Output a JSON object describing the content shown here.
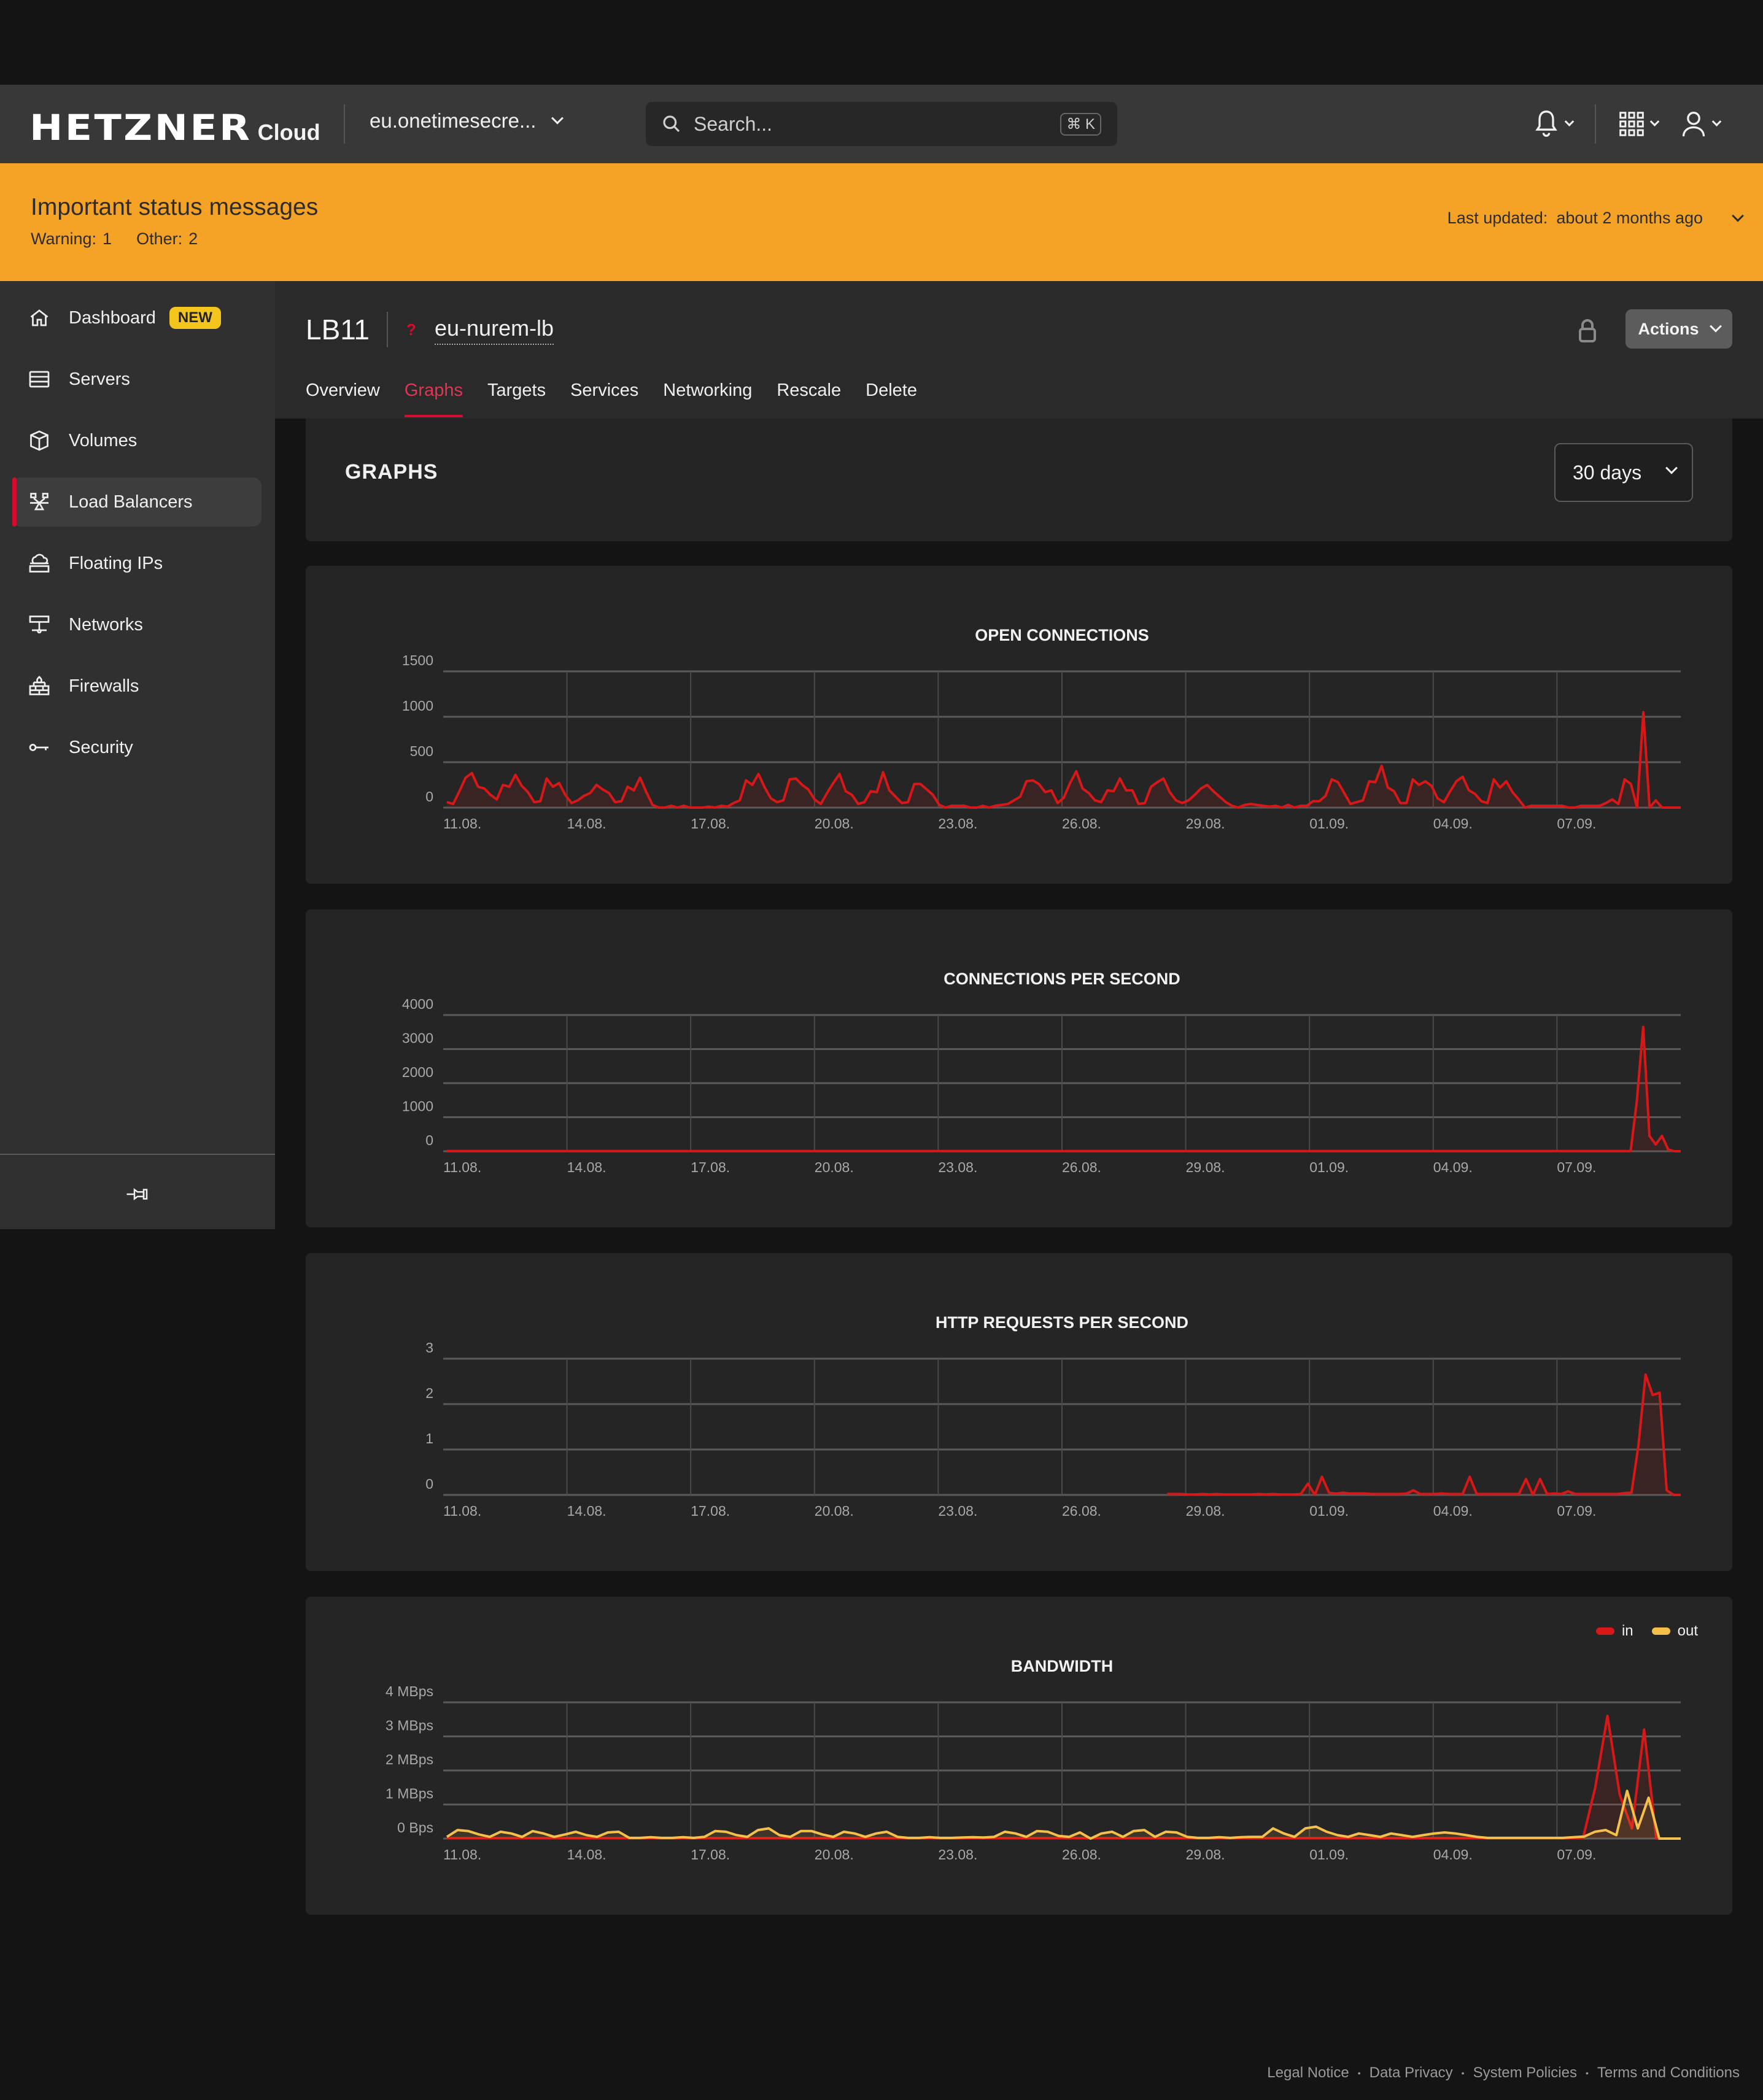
{
  "header": {
    "logo": "HETZNER",
    "product": "Cloud",
    "project": "eu.onetimesecre...",
    "search_placeholder": "Search...",
    "search_shortcut": "⌘ K",
    "icons": [
      "bell-icon",
      "apps-grid-icon",
      "user-icon"
    ]
  },
  "banner": {
    "title": "Important status messages",
    "warning_label": "Warning:",
    "warning_count": "1",
    "other_label": "Other:",
    "other_count": "2",
    "updated_label": "Last updated:",
    "updated_value": "about 2 months ago",
    "color": "#f5a327"
  },
  "sidebar": {
    "items": [
      {
        "label": "Dashboard",
        "icon": "home-icon",
        "badge": "NEW"
      },
      {
        "label": "Servers",
        "icon": "server-icon"
      },
      {
        "label": "Volumes",
        "icon": "cube-icon"
      },
      {
        "label": "Load Balancers",
        "icon": "load-balancer-icon",
        "active": true
      },
      {
        "label": "Floating IPs",
        "icon": "floating-ip-icon"
      },
      {
        "label": "Networks",
        "icon": "network-icon"
      },
      {
        "label": "Firewalls",
        "icon": "firewall-icon"
      },
      {
        "label": "Security",
        "icon": "key-icon"
      }
    ],
    "pin_icon": "pin-icon"
  },
  "page": {
    "type": "LB11",
    "status_marker": "?",
    "name": "eu-nurem-lb",
    "actions_label": "Actions",
    "tabs": [
      "Overview",
      "Graphs",
      "Targets",
      "Services",
      "Networking",
      "Rescale",
      "Delete"
    ],
    "active_tab": "Graphs",
    "accent": "#d50c2d"
  },
  "graphs": {
    "title": "GRAPHS",
    "range": "30 days"
  },
  "chart_data": [
    {
      "type": "area",
      "title": "OPEN CONNECTIONS",
      "x_ticks": [
        "11.08.",
        "14.08.",
        "17.08.",
        "20.08.",
        "23.08.",
        "26.08.",
        "29.08.",
        "01.09.",
        "04.09.",
        "07.09."
      ],
      "y_ticks": [
        "0",
        "500",
        "1000",
        "1500"
      ],
      "ylim": [
        0,
        1500
      ],
      "grid": true,
      "series": [
        {
          "name": "open connections",
          "color": "#d81818",
          "values": [
            60,
            40,
            180,
            330,
            380,
            230,
            210,
            140,
            90,
            250,
            230,
            360,
            240,
            170,
            60,
            70,
            320,
            230,
            270,
            140,
            50,
            80,
            130,
            160,
            250,
            200,
            160,
            60,
            70,
            230,
            190,
            330,
            170,
            30,
            0,
            0,
            20,
            0,
            20,
            0,
            0,
            0,
            10,
            0,
            20,
            10,
            50,
            80,
            300,
            250,
            370,
            220,
            100,
            60,
            80,
            310,
            320,
            250,
            200,
            90,
            40,
            160,
            270,
            370,
            180,
            140,
            40,
            60,
            180,
            170,
            390,
            190,
            120,
            50,
            60,
            260,
            260,
            200,
            140,
            30,
            0,
            20,
            20,
            20,
            0,
            0,
            20,
            0,
            20,
            30,
            40,
            80,
            120,
            290,
            300,
            260,
            170,
            190,
            50,
            110,
            270,
            400,
            210,
            160,
            80,
            60,
            190,
            180,
            320,
            190,
            190,
            40,
            50,
            230,
            280,
            320,
            170,
            80,
            50,
            80,
            140,
            210,
            250,
            180,
            120,
            60,
            20,
            0,
            30,
            40,
            30,
            20,
            10,
            20,
            0,
            30,
            0,
            20,
            20,
            70,
            70,
            130,
            310,
            280,
            160,
            40,
            60,
            80,
            290,
            280,
            460,
            220,
            180,
            50,
            50,
            310,
            250,
            290,
            240,
            100,
            60,
            180,
            290,
            340,
            190,
            150,
            70,
            50,
            310,
            220,
            290,
            170,
            90,
            0,
            20,
            20,
            20,
            20,
            20,
            20,
            0,
            0,
            20,
            20,
            20,
            20,
            50,
            90,
            40,
            310,
            260,
            0,
            1050,
            0,
            80,
            0,
            0,
            0,
            0
          ]
        }
      ]
    },
    {
      "type": "area",
      "title": "CONNECTIONS PER SECOND",
      "x_ticks": [
        "11.08.",
        "14.08.",
        "17.08.",
        "20.08.",
        "23.08.",
        "26.08.",
        "29.08.",
        "01.09.",
        "04.09.",
        "07.09."
      ],
      "y_ticks": [
        "0",
        "1000",
        "2000",
        "3000",
        "4000"
      ],
      "ylim": [
        0,
        4000
      ],
      "grid": true,
      "series": [
        {
          "name": "connections per second",
          "color": "#d81818",
          "values": [
            5,
            5,
            5,
            5,
            5,
            5,
            5,
            5,
            5,
            5,
            5,
            5,
            5,
            5,
            5,
            5,
            5,
            5,
            5,
            5,
            5,
            5,
            5,
            5,
            5,
            5,
            5,
            5,
            5,
            5,
            5,
            5,
            5,
            5,
            5,
            5,
            5,
            5,
            5,
            5,
            5,
            5,
            5,
            5,
            5,
            5,
            5,
            5,
            5,
            5,
            5,
            5,
            5,
            5,
            5,
            5,
            5,
            5,
            5,
            5,
            5,
            5,
            5,
            5,
            5,
            5,
            5,
            5,
            5,
            5,
            5,
            5,
            5,
            5,
            5,
            5,
            5,
            5,
            5,
            5,
            5,
            5,
            5,
            5,
            5,
            5,
            5,
            5,
            5,
            5,
            5,
            5,
            5,
            5,
            5,
            5,
            5,
            5,
            5,
            5,
            5,
            5,
            5,
            5,
            5,
            5,
            5,
            5,
            5,
            5,
            5,
            5,
            5,
            5,
            5,
            5,
            5,
            5,
            5,
            5,
            5,
            5,
            5,
            5,
            5,
            5,
            5,
            5,
            5,
            5,
            5,
            5,
            5,
            5,
            5,
            5,
            5,
            5,
            5,
            5,
            5,
            5,
            5,
            5,
            5,
            5,
            5,
            5,
            5,
            5,
            5,
            5,
            5,
            5,
            5,
            5,
            5,
            5,
            5,
            5,
            5,
            5,
            5,
            5,
            5,
            5,
            5,
            5,
            5,
            5,
            5,
            5,
            5,
            5,
            5,
            5,
            5,
            5,
            5,
            5,
            5,
            5,
            5,
            5,
            5,
            5,
            5,
            5,
            5,
            5,
            1500,
            3650,
            450,
            200,
            450,
            50,
            0,
            0
          ]
        }
      ]
    },
    {
      "type": "area",
      "title": "HTTP REQUESTS PER SECOND",
      "x_ticks": [
        "11.08.",
        "14.08.",
        "17.08.",
        "20.08.",
        "23.08.",
        "26.08.",
        "29.08.",
        "01.09.",
        "04.09.",
        "07.09."
      ],
      "y_ticks": [
        "0",
        "1",
        "2",
        "3"
      ],
      "ylim": [
        0,
        3
      ],
      "grid": true,
      "series": [
        {
          "name": "http requests per second",
          "color": "#d81818",
          "x_start_fraction": 0.585,
          "values": [
            0.02,
            0.02,
            0.02,
            0.01,
            0.01,
            0.02,
            0.01,
            0.02,
            0.01,
            0.01,
            0.01,
            0.01,
            0.01,
            0.02,
            0.01,
            0.02,
            0.01,
            0.01,
            0.01,
            0.02,
            0.25,
            0.0,
            0.4,
            0.05,
            0.03,
            0.05,
            0.03,
            0.03,
            0.03,
            0.02,
            0.02,
            0.02,
            0.02,
            0.02,
            0.03,
            0.1,
            0.02,
            0.02,
            0.02,
            0.03,
            0.02,
            0.02,
            0.02,
            0.4,
            0.02,
            0.02,
            0.02,
            0.02,
            0.02,
            0.02,
            0.02,
            0.35,
            0.0,
            0.35,
            0.02,
            0.03,
            0.02,
            0.08,
            0.02,
            0.02,
            0.02,
            0.02,
            0.02,
            0.02,
            0.02,
            0.04,
            0.05,
            1.1,
            2.65,
            2.2,
            2.25,
            0.1,
            0.0,
            0.0
          ]
        }
      ]
    },
    {
      "type": "area",
      "title": "BANDWIDTH",
      "x_ticks": [
        "11.08.",
        "14.08.",
        "17.08.",
        "20.08.",
        "23.08.",
        "26.08.",
        "29.08.",
        "01.09.",
        "04.09.",
        "07.09."
      ],
      "y_ticks": [
        "0 Bps",
        "1 MBps",
        "2 MBps",
        "3 MBps",
        "4 MBps"
      ],
      "ylim": [
        0,
        4
      ],
      "y_unit": "MBps",
      "grid": true,
      "legend": {
        "position": "top-right",
        "entries": [
          "in",
          "out"
        ]
      },
      "series": [
        {
          "name": "in",
          "color": "#d81818",
          "values": [
            0.01,
            0.01,
            0.01,
            0.01,
            0.01,
            0.01,
            0.01,
            0.01,
            0.01,
            0.01,
            0.01,
            0.01,
            0.01,
            0.01,
            0.01,
            0.01,
            0.01,
            0.01,
            0.01,
            0.01,
            0.01,
            0.01,
            0.01,
            0.01,
            0.01,
            0.01,
            0.01,
            0.01,
            0.01,
            0.01,
            0.01,
            0.01,
            0.01,
            0.01,
            0.01,
            0.01,
            0.01,
            0.01,
            0.01,
            0.01,
            0.01,
            0.01,
            0.01,
            0.01,
            0.01,
            0.01,
            0.01,
            0.01,
            0.01,
            0.01,
            0.01,
            0.01,
            0.01,
            0.01,
            0.01,
            0.01,
            0.01,
            0.01,
            0.01,
            0.01,
            0.01,
            0.01,
            0.01,
            0.01,
            0.01,
            0.01,
            0.01,
            0.01,
            0.01,
            0.01,
            0.01,
            0.01,
            0.01,
            0.01,
            0.01,
            0.01,
            0.01,
            0.01,
            0.01,
            0.01,
            0.01,
            0.01,
            0.01,
            0.01,
            0.01,
            0.01,
            0.01,
            0.01,
            0.01,
            0.01,
            0.01,
            0.01,
            0.01,
            0.01,
            1.5,
            3.6,
            1.3,
            0.3,
            3.2,
            0.0,
            0.0,
            0.0
          ]
        },
        {
          "name": "out",
          "color": "#f4c04a",
          "values": [
            0.05,
            0.25,
            0.22,
            0.12,
            0.05,
            0.2,
            0.15,
            0.05,
            0.22,
            0.15,
            0.05,
            0.12,
            0.2,
            0.1,
            0.05,
            0.18,
            0.2,
            0.02,
            0.02,
            0.04,
            0.02,
            0.02,
            0.04,
            0.02,
            0.05,
            0.22,
            0.2,
            0.1,
            0.05,
            0.25,
            0.3,
            0.1,
            0.05,
            0.22,
            0.22,
            0.12,
            0.05,
            0.2,
            0.15,
            0.05,
            0.15,
            0.2,
            0.05,
            0.02,
            0.02,
            0.04,
            0.02,
            0.02,
            0.03,
            0.04,
            0.03,
            0.05,
            0.2,
            0.15,
            0.05,
            0.22,
            0.2,
            0.08,
            0.05,
            0.18,
            0.0,
            0.15,
            0.2,
            0.05,
            0.22,
            0.25,
            0.05,
            0.2,
            0.18,
            0.05,
            0.02,
            0.02,
            0.04,
            0.02,
            0.04,
            0.05,
            0.05,
            0.3,
            0.15,
            0.05,
            0.3,
            0.35,
            0.2,
            0.1,
            0.05,
            0.15,
            0.1,
            0.05,
            0.15,
            0.1,
            0.05,
            0.1,
            0.15,
            0.18,
            0.15,
            0.1,
            0.05,
            0.02,
            0.02,
            0.02,
            0.02,
            0.02,
            0.02,
            0.02,
            0.02,
            0.04,
            0.06,
            0.2,
            0.25,
            0.1,
            1.4,
            0.3,
            1.2,
            0.0,
            0.0,
            0.0
          ]
        }
      ]
    }
  ],
  "footer": {
    "links": [
      "Legal Notice",
      "Data Privacy",
      "System Policies",
      "Terms and Conditions"
    ]
  }
}
